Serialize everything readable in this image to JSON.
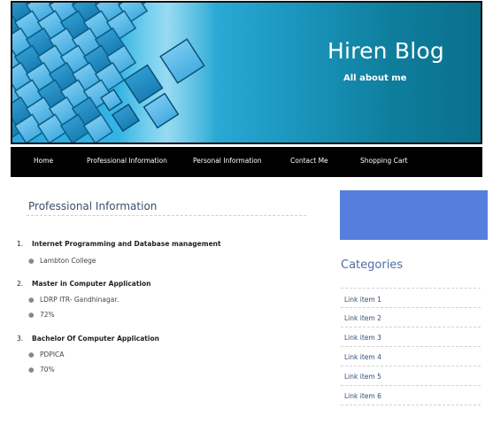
{
  "header": {
    "title": "Hiren Blog",
    "tagline": "All about me"
  },
  "nav": {
    "items": [
      "Home",
      "Professional Information",
      "Personal Information",
      "Contact Me",
      "Shopping Cart"
    ]
  },
  "main": {
    "heading": "Professional Information",
    "education": [
      {
        "number": "1.",
        "title": "Internet Programming and Database management",
        "details": [
          "Lambton College"
        ]
      },
      {
        "number": "2.",
        "title": "Master in Computer Application",
        "details": [
          "LDRP ITR- Gandhinagar.",
          "72%"
        ]
      },
      {
        "number": "3.",
        "title": "Bachelor Of Computer Application",
        "details": [
          "PDPICA",
          "70%"
        ]
      }
    ]
  },
  "sidebar": {
    "box_color": "#567fdd",
    "categories_title": "Categories",
    "links": [
      "Link item 1",
      "Link item 2",
      "Link item 3",
      "Link item 4",
      "Link item 5",
      "Link item 6"
    ]
  },
  "colors": {
    "nav_bg": "#000000",
    "banner_accent": "#27a7de"
  }
}
